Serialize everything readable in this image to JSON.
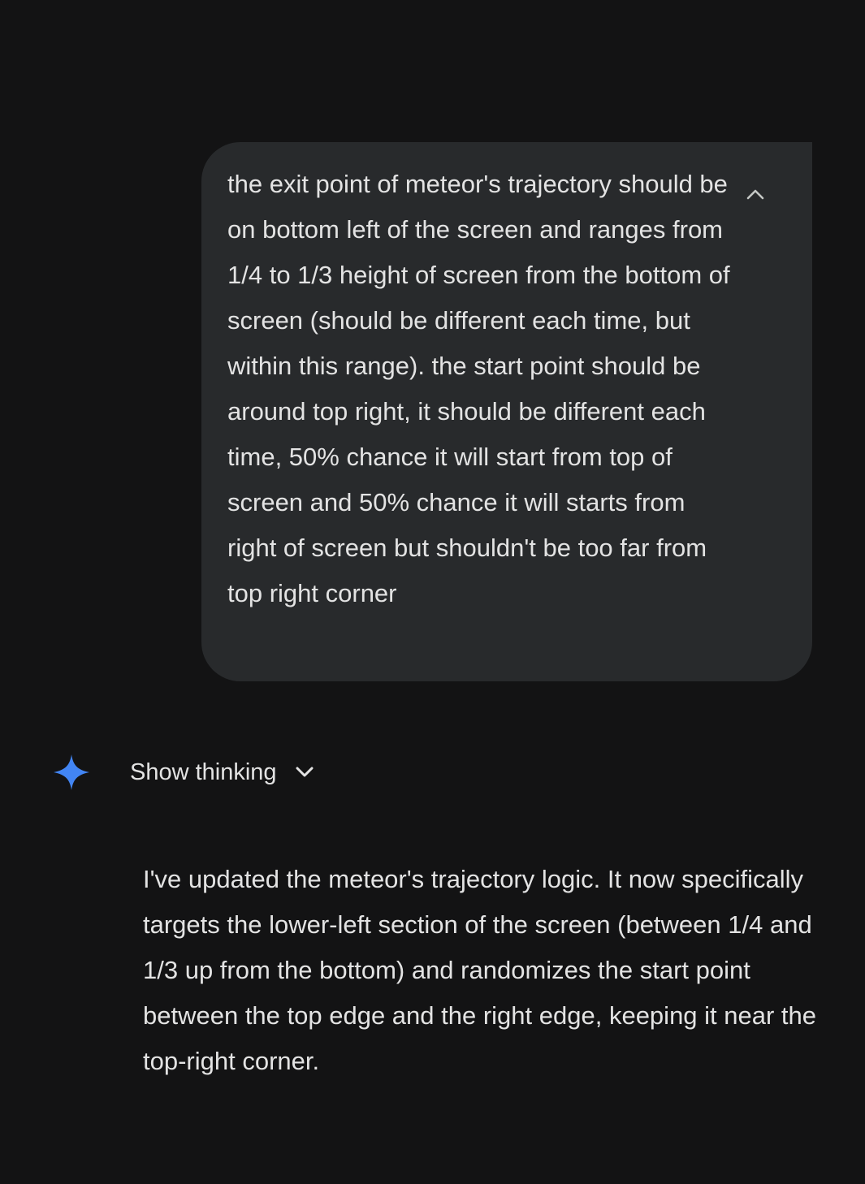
{
  "user_message": {
    "text": "the exit point of meteor's trajectory should be on bottom left of the screen and ranges from 1/4 to 1/3 height of screen from the bottom of screen (should be different each time, but within this range). the start point should be around top right, it should be different each time, 50% chance it will start from top of screen and 50% chance it will starts from right of screen but shouldn't be too far from top right corner",
    "toggle_icon": "chevron-up-icon"
  },
  "response": {
    "logo_icon": "gemini-sparkle-icon",
    "show_thinking_label": "Show thinking",
    "show_thinking_icon": "chevron-down-icon",
    "text": "I've updated the meteor's trajectory logic. It now specifically targets the lower-left section of the screen (between 1/4 and 1/3 up from the bottom) and randomizes the start point between the top edge and the right edge, keeping it near the top-right corner."
  },
  "colors": {
    "background": "#131314",
    "bubble": "#282a2c",
    "text": "#e3e3e3",
    "accent": "#4285f4"
  }
}
